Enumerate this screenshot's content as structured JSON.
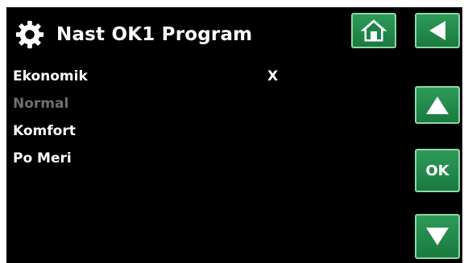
{
  "header": {
    "title": "Nast OK1 Program"
  },
  "buttons": {
    "ok_label": "OK"
  },
  "menu": {
    "items": [
      {
        "label": "Ekonomik",
        "mark": "X",
        "state": "active"
      },
      {
        "label": "Normal",
        "mark": "",
        "state": "disabled"
      },
      {
        "label": "Komfort",
        "mark": "",
        "state": "active"
      },
      {
        "label": "Po Meri",
        "mark": "",
        "state": "active"
      }
    ]
  },
  "colors": {
    "background": "#000000",
    "button_green": "#2e9b59",
    "text": "#ffffff",
    "disabled_text": "#6f6f6f"
  },
  "icons": {
    "title": "gear-icon",
    "home": "home-icon",
    "back": "back-arrow-icon",
    "up": "up-arrow-icon",
    "down": "down-arrow-icon"
  }
}
